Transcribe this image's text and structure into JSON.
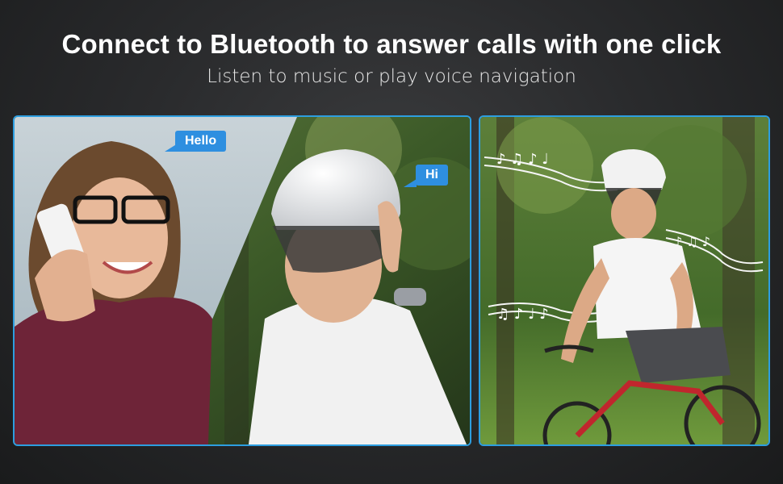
{
  "header": {
    "title": "Connect to Bluetooth to answer calls with one click",
    "subtitle": "Listen to music or play voice navigation"
  },
  "left_photo": {
    "bubble_left": "Hello",
    "bubble_right": "Hi"
  },
  "colors": {
    "accent_border": "#2d9ee0",
    "bubble": "#2e8fe0"
  }
}
